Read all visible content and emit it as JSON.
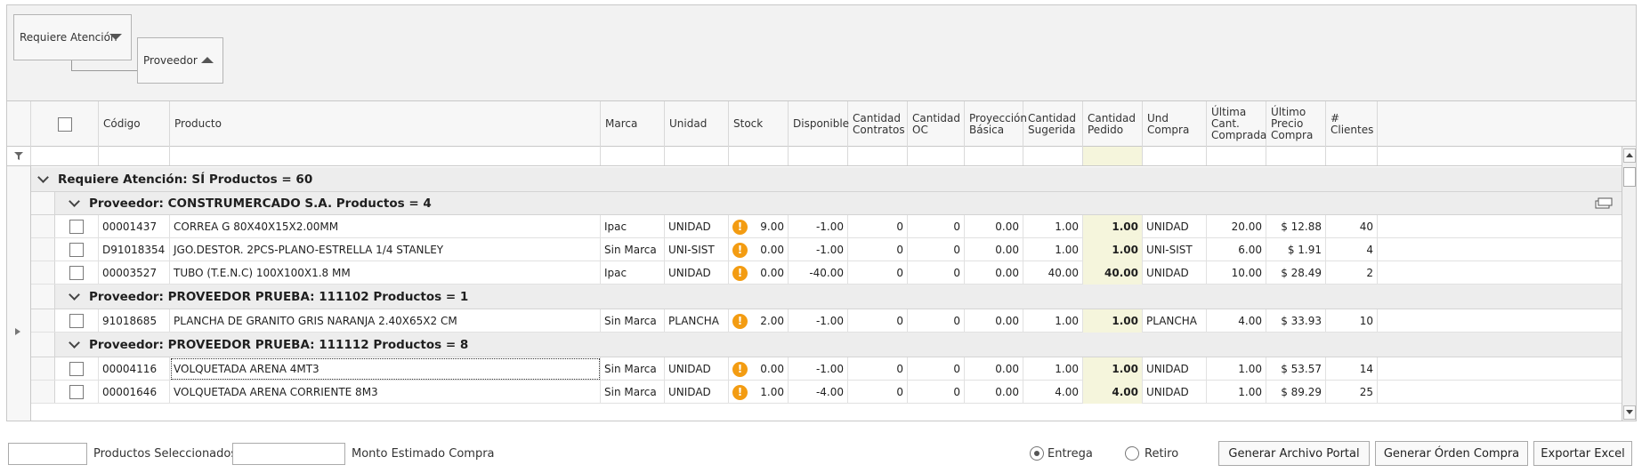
{
  "grouping": {
    "chips": [
      {
        "label": "Requiere Atención",
        "sort": "descending"
      },
      {
        "label": "Proveedor",
        "sort": "ascending"
      }
    ]
  },
  "columns": [
    "Código",
    "Producto",
    "Marca",
    "Unidad",
    "Stock",
    "Disponible",
    "Cantidad Contratos",
    "Cantidad OC",
    "Proyección Básica",
    "Cantidad Sugerida",
    "Cantidad Pedido",
    "Und Compra",
    "Última Cant. Comprada",
    "Último Precio Compra",
    "# Clientes"
  ],
  "groups": {
    "top": "Requiere Atención: SÍ Productos = 60",
    "suppliers": [
      {
        "label": "Proveedor: CONSTRUMERCADO S.A. Productos = 4",
        "rows": [
          [
            "00001437",
            "CORREA G 80X40X15X2.00MM",
            "Ipac",
            "UNIDAD",
            "9.00",
            "-1.00",
            "0",
            "0",
            "0.00",
            "1.00",
            "1.00",
            "UNIDAD",
            "20.00",
            "$ 12.88",
            "40"
          ],
          [
            "D91018354",
            "JGO.DESTOR. 2PCS-PLANO-ESTRELLA 1/4 STANLEY",
            "Sin Marca",
            "UNI-SIST",
            "0.00",
            "-1.00",
            "0",
            "0",
            "0.00",
            "1.00",
            "1.00",
            "UNI-SIST",
            "6.00",
            "$ 1.91",
            "4"
          ],
          [
            "00003527",
            "TUBO (T.E.N.C) 100X100X1.8 MM",
            "Ipac",
            "UNIDAD",
            "0.00",
            "-40.00",
            "0",
            "0",
            "0.00",
            "40.00",
            "40.00",
            "UNIDAD",
            "10.00",
            "$ 28.49",
            "2"
          ]
        ]
      },
      {
        "label": "Proveedor: PROVEEDOR PRUEBA: 111102 Productos = 1",
        "rows": [
          [
            "91018685",
            "PLANCHA DE GRANITO GRIS NARANJA 2.40X65X2 CM",
            "Sin Marca",
            "PLANCHA",
            "2.00",
            "-1.00",
            "0",
            "0",
            "0.00",
            "1.00",
            "1.00",
            "PLANCHA",
            "4.00",
            "$ 33.93",
            "10"
          ]
        ]
      },
      {
        "label": "Proveedor: PROVEEDOR PRUEBA: 111112 Productos = 8",
        "rows": [
          [
            "00004116",
            "VOLQUETADA ARENA 4MT3",
            "Sin Marca",
            "UNIDAD",
            "0.00",
            "-1.00",
            "0",
            "0",
            "0.00",
            "1.00",
            "1.00",
            "UNIDAD",
            "1.00",
            "$ 53.57",
            "14"
          ],
          [
            "00001646",
            "VOLQUETADA ARENA CORRIENTE 8M3",
            "Sin Marca",
            "UNIDAD",
            "1.00",
            "-4.00",
            "0",
            "0",
            "0.00",
            "4.00",
            "4.00",
            "UNIDAD",
            "1.00",
            "$ 89.29",
            "25"
          ]
        ]
      }
    ]
  },
  "warning_glyph": "!",
  "footer": {
    "selected_label": "Productos Seleccionados",
    "estimate_label": "Monto Estimado Compra",
    "radio_entrega": "Entrega",
    "radio_retiro": "Retiro",
    "btn_portal": "Generar Archivo Portal",
    "btn_orden": "Generar Órden Compra",
    "btn_excel": "Exportar Excel"
  },
  "colors": {
    "warning": "#f39c12",
    "pedido_bg": "#f5f5dc",
    "group_bg": "#ededed"
  }
}
